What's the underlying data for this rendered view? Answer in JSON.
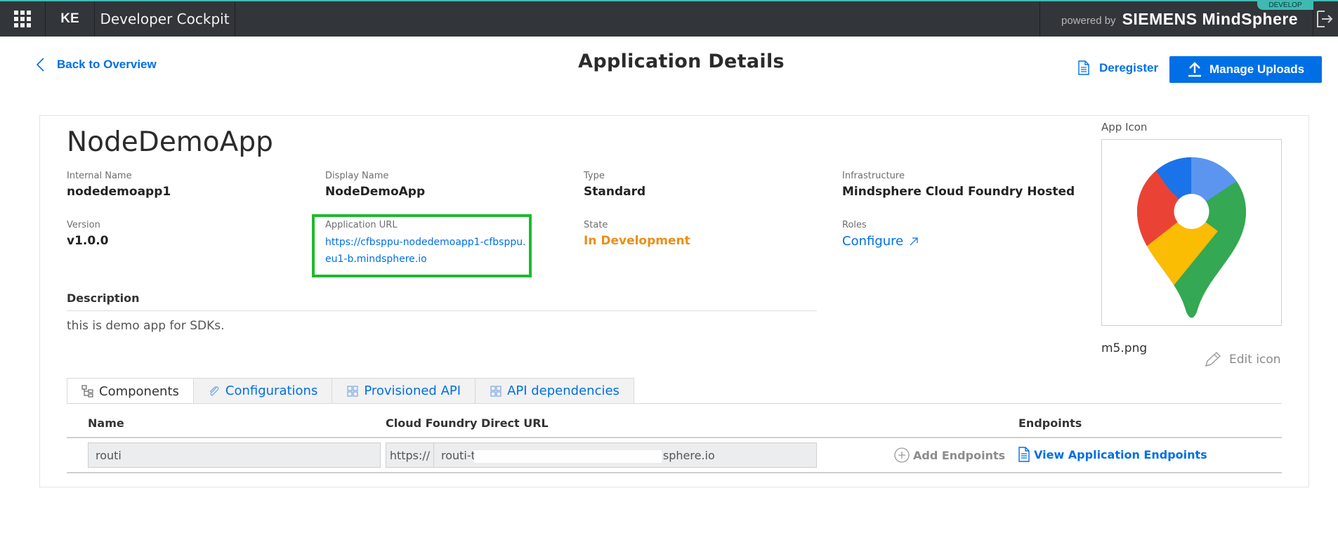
{
  "topbar": {
    "tenant": "KE",
    "app_title": "Developer Cockpit",
    "powered_by": "powered by",
    "brand_name": "SIEMENS MindSphere",
    "env_tag": "DEVELOP"
  },
  "header": {
    "back_label": "Back to Overview",
    "page_title": "Application Details",
    "deregister_label": "Deregister",
    "manage_uploads_label": "Manage Uploads"
  },
  "app": {
    "name": "NodeDemoApp",
    "internal_name_label": "Internal Name",
    "internal_name": "nodedemoapp1",
    "display_name_label": "Display Name",
    "display_name": "NodeDemoApp",
    "type_label": "Type",
    "type": "Standard",
    "infrastructure_label": "Infrastructure",
    "infrastructure": "Mindsphere Cloud Foundry Hosted",
    "version_label": "Version",
    "version": "v1.0.0",
    "url_label": "Application URL",
    "url": "https://cfbsppu-nodedemoapp1-cfbsppu.eu1-b.mindsphere.io",
    "state_label": "State",
    "state": "In Development",
    "roles_label": "Roles",
    "roles_link": "Configure",
    "description_label": "Description",
    "description": "this is demo app for SDKs."
  },
  "app_icon": {
    "label": "App Icon",
    "file_name": "m5.png",
    "edit_label": "Edit icon"
  },
  "tabs": [
    {
      "label": "Components",
      "active": true
    },
    {
      "label": "Configurations",
      "active": false
    },
    {
      "label": "Provisioned API",
      "active": false
    },
    {
      "label": "API dependencies",
      "active": false
    }
  ],
  "components_table": {
    "headers": {
      "name": "Name",
      "cf_url": "Cloud Foundry Direct URL",
      "endpoints": "Endpoints"
    },
    "rows": [
      {
        "name": "routi",
        "url_prefix": "https://",
        "url_start": "routi-t",
        "url_end": "sphere.io",
        "add_endpoints": "Add Endpoints",
        "view_endpoints": "View Application Endpoints"
      }
    ]
  },
  "colors": {
    "topbar": "#323539",
    "accent": "#3fb9b2",
    "link": "#006fe6",
    "state": "#ea8f17",
    "highlight_box": "#1dba2f"
  }
}
